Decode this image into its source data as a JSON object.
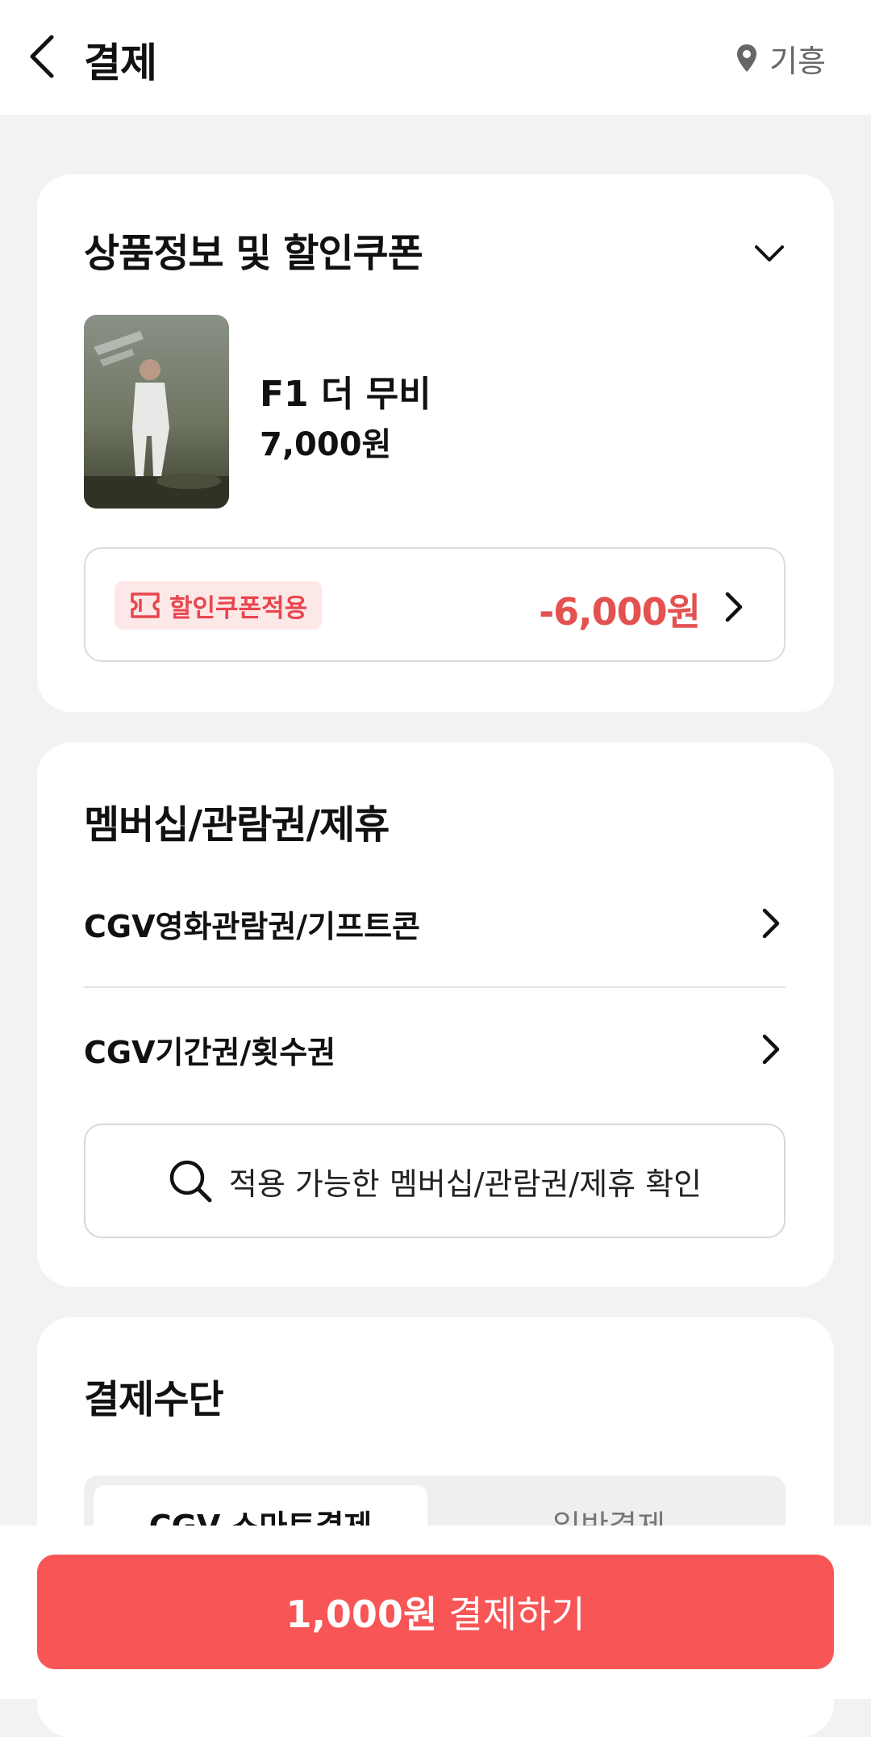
{
  "header": {
    "title": "결제",
    "location": "기흥"
  },
  "product_card": {
    "title": "상품정보 및 할인쿠폰",
    "movie_title": "F1 더 무비",
    "movie_price": "7,000원",
    "coupon_label": "할인쿠폰적용",
    "coupon_amount": "-6,000원"
  },
  "membership_card": {
    "title": "멤버십/관람권/제휴",
    "items": [
      {
        "label": "CGV영화관람권/기프트콘"
      },
      {
        "label": "CGV기간권/횟수권"
      }
    ],
    "check_button": "적용 가능한 멤버십/관람권/제휴 확인"
  },
  "payment_card": {
    "title": "결제수단",
    "tabs": [
      {
        "label": "CGV 스마트결제",
        "active": true
      },
      {
        "label": "일반결제",
        "active": false
      }
    ]
  },
  "bottom": {
    "amount": "1,000원",
    "action": "결제하기"
  },
  "colors": {
    "accent": "#f75556",
    "coupon_text": "#e35250",
    "coupon_badge_bg": "#fde8e8",
    "page_bg": "#f2f2f2"
  }
}
